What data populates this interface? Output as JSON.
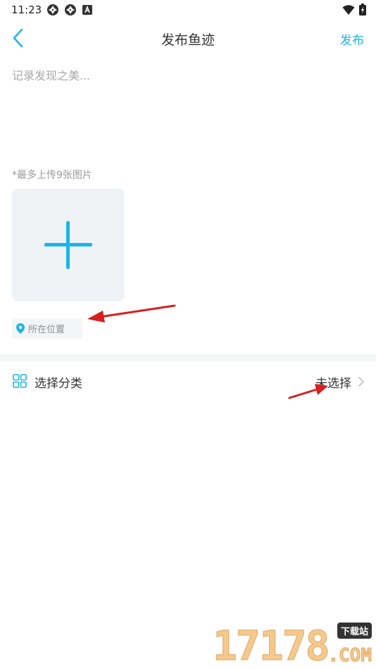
{
  "status_bar": {
    "time": "11:23",
    "icons_left": [
      "pinwheel-icon",
      "pinwheel-icon",
      "a-box-icon"
    ],
    "icons_right": [
      "wifi-icon",
      "battery-charging-icon"
    ]
  },
  "nav": {
    "back_icon": "chevron-left-icon",
    "title": "发布鱼迹",
    "publish_label": "发布"
  },
  "post": {
    "placeholder": "记录发现之美...",
    "value": ""
  },
  "upload": {
    "hint": "*最多上传9张图片",
    "add_icon": "plus-icon"
  },
  "location": {
    "icon": "location-pin-icon",
    "label": "所在位置"
  },
  "category": {
    "icon": "grid-icon",
    "label": "选择分类",
    "value": "未选择",
    "chevron": "chevron-right-icon"
  },
  "watermark": {
    "number": "17178",
    "badge": "下载站",
    "domain": ".COM"
  },
  "colors": {
    "accent": "#1ab4e8",
    "annotation_red": "#d62020",
    "divider": "#f4f5f7",
    "tile_bg": "#f0f3f6"
  }
}
